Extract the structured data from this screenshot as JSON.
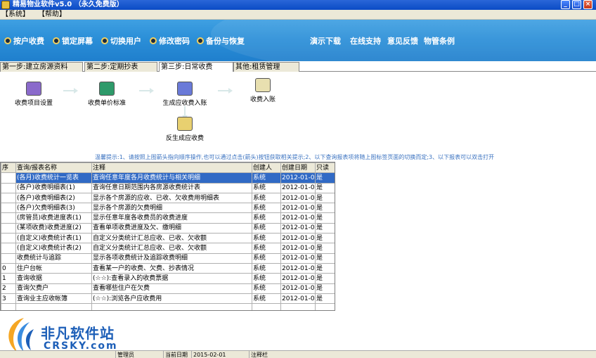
{
  "window": {
    "title": "精易物业软件v5.0 （永久免费版）",
    "controls": [
      "minimize",
      "maximize",
      "close"
    ]
  },
  "menu": {
    "items": [
      "【系统】",
      "【帮助】"
    ]
  },
  "toolbar": {
    "buttons": [
      "按户收费",
      "锁定屏幕",
      "切换用户",
      "修改密码",
      "备份与恢复"
    ],
    "links": [
      "演示下载",
      "在线支持",
      "意见反馈",
      "物管条例"
    ]
  },
  "steps": {
    "tabs": [
      "第一步:建立房源资料",
      "第二步:定期抄表",
      "第三步:日常收费",
      "其他:租赁管理"
    ],
    "active_index": 2
  },
  "flow": {
    "nodes": [
      "收费项目设置",
      "收费单价标准",
      "生成应收费入账",
      "收费入账",
      "反生成应收费"
    ]
  },
  "hint": "温馨提示:1、请按照上图箭头指向顺序操作,也可以通过点击(箭头)按钮获取相关提示;2、以下查询报表项将随上图标签页面的切换而定;3、以下报表可以双击打开",
  "table": {
    "columns": [
      "序",
      "查询/报表名称",
      "注释",
      "创建人",
      "创建日期",
      "只读"
    ],
    "rows": [
      [
        "",
        "(各月)收费统计一览表",
        "查询任意年度各月收费统计与相关明细",
        "系统",
        "2012-01-01",
        "是"
      ],
      [
        "",
        "(各户)收费明细表(1)",
        "查询任意日期范围内各房源收费统计表",
        "系统",
        "2012-01-01",
        "是"
      ],
      [
        "",
        "(各户)收费明细表(2)",
        "显示各个房源的应收、已收、欠收费用明细表",
        "系统",
        "2012-01-01",
        "是"
      ],
      [
        "",
        "(各户)欠费明细表(3)",
        "显示各个房源的欠费明细",
        "系统",
        "2012-01-01",
        "是"
      ],
      [
        "",
        "(房管员)收费进度表(1)",
        "显示任意年度各收费员的收费进度",
        "系统",
        "2012-01-01",
        "是"
      ],
      [
        "",
        "(某项收费)收费进度(2)",
        "查看单项收费进度及欠、缴明细",
        "系统",
        "2012-01-01",
        "是"
      ],
      [
        "",
        "(自定义)收费统计表(1)",
        "自定义分类统计汇总应收、已收、欠收额",
        "系统",
        "2012-01-01",
        "是"
      ],
      [
        "",
        "(自定义)收费统计表(2)",
        "自定义分类统计汇总应收、已收、欠收额",
        "系统",
        "2012-01-01",
        "是"
      ],
      [
        "",
        "收费统计与追踪",
        "显示各项收费统计及追踪收费明细",
        "系统",
        "2012-01-01",
        "是"
      ],
      [
        "0",
        "住户台帐",
        "查看某一户的收费、欠费、抄表情况",
        "系统",
        "2012-01-01",
        "是"
      ],
      [
        "1",
        "查询收据",
        "(☆☆):查看录入的收费票据",
        "系统",
        "2012-01-01",
        "是"
      ],
      [
        "2",
        "查询欠费户",
        "查看哪些住户在欠费",
        "系统",
        "2012-01-01",
        "是"
      ],
      [
        "3",
        "查询业主应收帐簿",
        "(☆☆):浏览各户应收费用",
        "系统",
        "2012-01-01",
        "是"
      ],
      [
        "",
        "",
        "",
        "",
        "",
        ""
      ],
      [
        "",
        "",
        "",
        "",
        "",
        ""
      ]
    ],
    "selected_row": 0
  },
  "watermark": {
    "title": "非凡软件站",
    "subtitle": "CRSKY.com"
  },
  "statusbar": {
    "cells": [
      "",
      "管理员",
      "当前日期",
      "2015-02-01",
      "注释栏"
    ]
  },
  "colors": {
    "banner": "#2b8fd8",
    "selection": "#316ac5",
    "hint": "#3a72c0"
  }
}
